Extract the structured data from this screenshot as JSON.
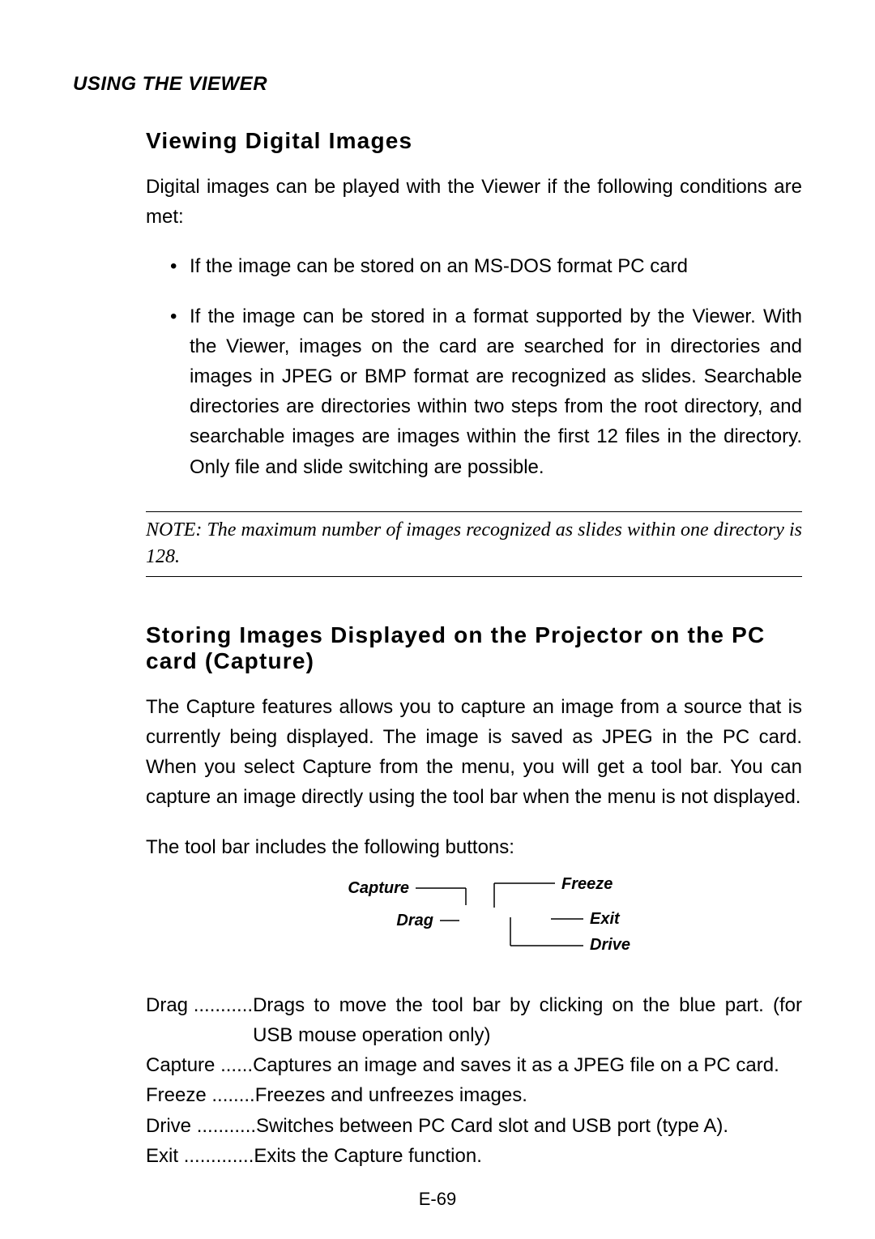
{
  "header": "USING THE VIEWER",
  "section1": {
    "title": "Viewing Digital Images",
    "intro": "Digital images can be played with the Viewer if the following conditions are met:",
    "bullets": [
      "If the image can be stored on an MS-DOS format PC card",
      "If the image can be stored in a format supported by the Viewer. With the Viewer, images on the card are searched for in directories and images in JPEG or BMP format are recognized as slides. Searchable directories are directories within two steps from the root directory, and searchable images are images within the first 12 files in the directory. Only file and slide switching are possible."
    ],
    "note": "NOTE: The maximum number of images recognized as slides within one directory is 128."
  },
  "section2": {
    "title": "Storing Images Displayed on the Projector on the PC card (Capture)",
    "para": "The Capture features allows you to capture an image from a source that is currently being displayed. The image is saved as JPEG in the PC card. When you select Capture from the menu, you will get a tool bar. You can capture an image directly using the tool bar when the menu is not displayed.",
    "toolbarIntro": "The tool bar includes the following buttons:",
    "diagramLabels": {
      "capture": "Capture",
      "drag": "Drag",
      "freeze": "Freeze",
      "exit": "Exit",
      "drive": "Drive"
    },
    "definitions": [
      {
        "term": "Drag",
        "dots": "...........",
        "desc": "Drags to move the tool bar by clicking on the blue part. (for USB mouse operation only)"
      },
      {
        "term": "Capture",
        "dots": "......",
        "desc": "Captures an image and saves it as a JPEG file on a PC card."
      },
      {
        "term": "Freeze",
        "dots": "........",
        "desc": "Freezes and unfreezes images."
      },
      {
        "term": "Drive",
        "dots": "...........",
        "desc": "Switches between PC Card slot and USB port (type A)."
      },
      {
        "term": "Exit",
        "dots": ".............",
        "desc": "Exits the Capture function."
      }
    ]
  },
  "pageNum": "E-69"
}
